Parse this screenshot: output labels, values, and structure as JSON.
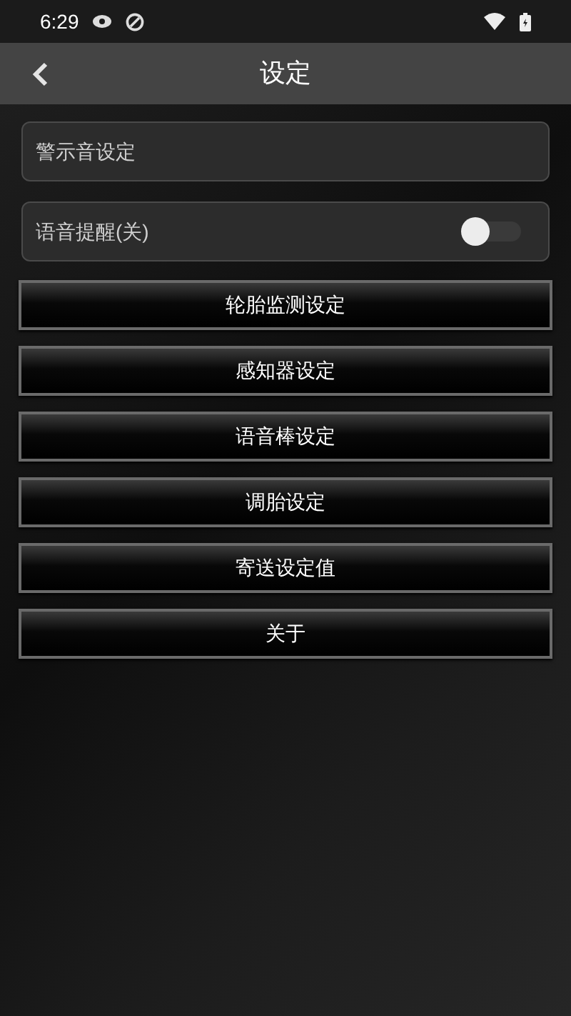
{
  "status_bar": {
    "time": "6:29"
  },
  "app_bar": {
    "title": "设定"
  },
  "settings": [
    {
      "kind": "link",
      "label": "警示音设定"
    },
    {
      "kind": "switch",
      "label": "语音提醒(关)",
      "on": false
    }
  ],
  "buttons": [
    "轮胎监测设定",
    "感知器设定",
    "语音棒设定",
    "调胎设定",
    "寄送设定值",
    "关于"
  ]
}
